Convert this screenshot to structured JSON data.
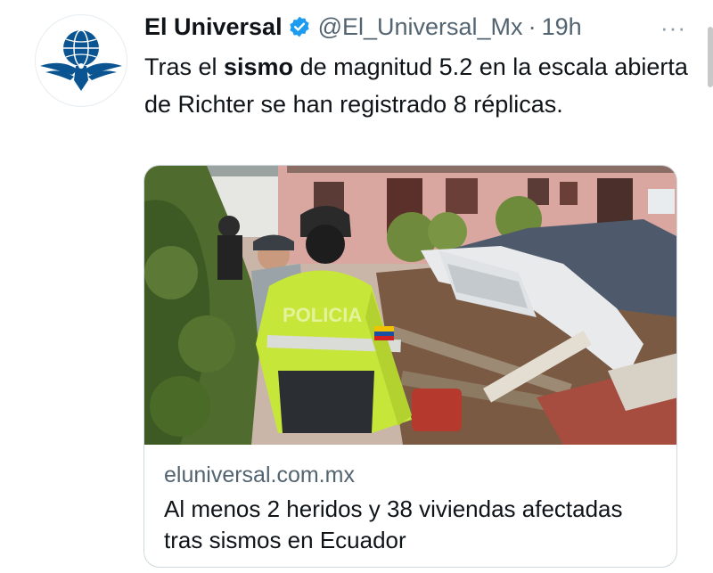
{
  "tweet": {
    "author_name": "El Universal",
    "handle": "@El_Universal_Mx",
    "separator": "·",
    "time": "19h",
    "more_label": "···",
    "text_before": "Tras el ",
    "text_bold": "sismo",
    "text_after": " de magnitud 5.2 en la escala abierta de Richter se han registrado 8 réplicas."
  },
  "card": {
    "domain": "eluniversal.com.mx",
    "title": "Al menos 2 heridos y 38 viviendas afectadas tras sismos en Ecuador",
    "image_vest_text": "POLICIA"
  },
  "colors": {
    "verified": "#1d9bf0",
    "logo": "#0a5591",
    "secondary_text": "#536471"
  },
  "icons": {
    "verified": "verified-badge-icon",
    "more": "more-options-icon",
    "avatar": "el-universal-logo"
  }
}
